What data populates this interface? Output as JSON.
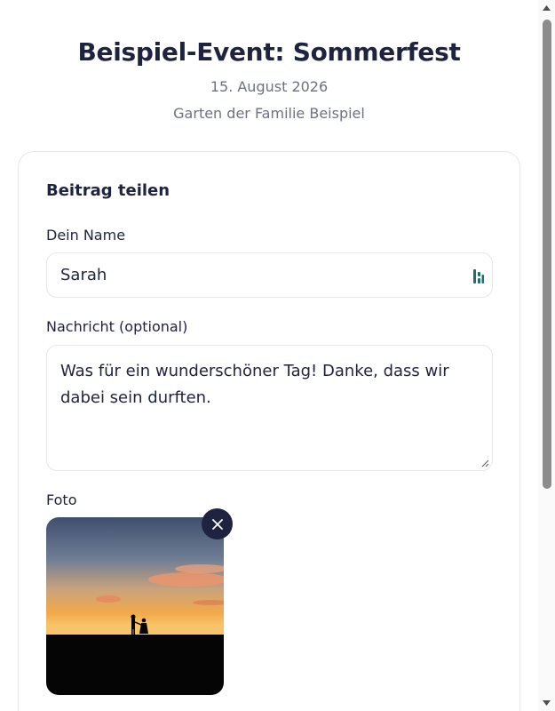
{
  "event": {
    "title": "Beispiel-Event: Sommerfest",
    "date": "15. August 2026",
    "location": "Garten der Familie Beispiel"
  },
  "form": {
    "heading": "Beitrag teilen",
    "name_label": "Dein Name",
    "name_value": "Sarah",
    "message_label": "Nachricht (optional)",
    "message_value": "Was für ein wunderschöner Tag! Danke, dass wir dabei sein durften.",
    "photo_label": "Foto",
    "photo_remove_icon": "close-icon",
    "name_field_icon": "password-manager-icon"
  },
  "colors": {
    "text_dark": "#1e2340",
    "text_muted": "#6b7280",
    "border": "#e5e7eb",
    "accent_icon": "#1f6f6b"
  }
}
